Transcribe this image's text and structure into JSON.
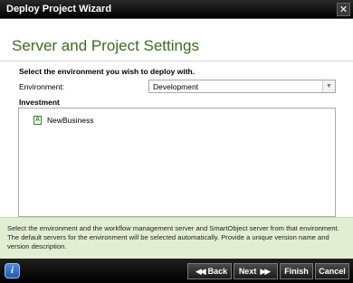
{
  "window": {
    "title": "Deploy Project Wizard",
    "close_glyph": "✕"
  },
  "page": {
    "title": "Server and Project Settings",
    "instruction": "Select the environment you wish to deploy with.",
    "environment_label": "Environment:",
    "environment_value": "Development",
    "investment_header": "Investment",
    "tree_items": [
      {
        "label": "NewBusiness",
        "icon": "project-icon",
        "icon_glyph": "A"
      }
    ]
  },
  "help_text": "Select the environment and the workflow management server and SmartObject server from that environment. The default servers for the environment will be selected automatically.  Provide a unique version name and version description.",
  "footer": {
    "info_glyph": "i",
    "back": {
      "glyph": "◀◀",
      "label": "Back"
    },
    "next": {
      "glyph": "▶▶",
      "label": "Next"
    },
    "finish": {
      "label": "Finish"
    },
    "cancel": {
      "label": "Cancel"
    }
  },
  "colors": {
    "title_accent": "#3b6b1e",
    "help_background": "#e2eed2",
    "info_button": "#2f6fcf",
    "chrome_dark": "#000000"
  }
}
